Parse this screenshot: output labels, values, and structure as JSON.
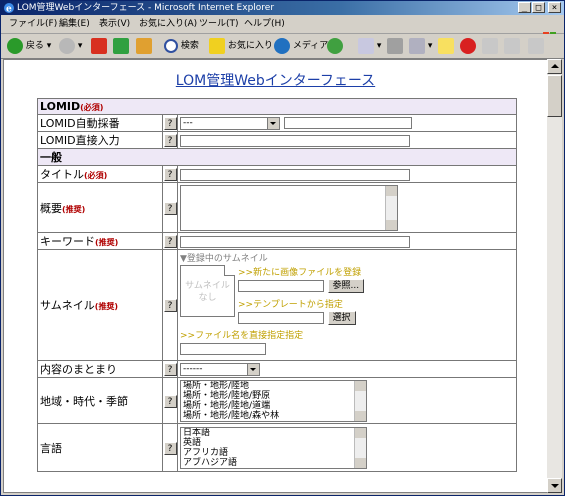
{
  "window": {
    "title": "LOM管理Webインターフェース - Microsoft Internet Explorer",
    "controls": {
      "minimize": "_",
      "maximize": "□",
      "close": "×"
    }
  },
  "menu": [
    "ファイル(F)",
    "編集(E)",
    "表示(V)",
    "お気に入り(A)",
    "ツール(T)",
    "ヘルプ(H)"
  ],
  "toolbar": {
    "back": "戻る",
    "search": "検索",
    "favorites": "お気に入り",
    "media": "メディア"
  },
  "page": {
    "title": "LOM管理Webインターフェース",
    "help_label": "?",
    "required_mark": "(必須)",
    "recommended_mark": "(推奨)",
    "sections": {
      "lomid": "LOMID",
      "general": "一般"
    },
    "rows": {
      "auto_number": {
        "label": "LOMID自動採番",
        "select_value": "---"
      },
      "direct_input": {
        "label": "LOMID直接入力"
      },
      "title": {
        "label": "タイトル"
      },
      "description": {
        "label": "概要"
      },
      "keyword": {
        "label": "キーワード"
      },
      "thumbnail": {
        "label": "サムネイル",
        "registered": "▼登録中のサムネイル",
        "placeholder_line1": "サムネイル",
        "placeholder_line2": "なし",
        "new_upload": ">>新たに画像ファイルを登録",
        "browse_button": "参照...",
        "from_template": ">>テンプレートから指定",
        "select_button": "選択",
        "direct_filename": ">>ファイル名を直接指定指定"
      },
      "aggregation": {
        "label": "内容のまとまり",
        "select_value": "------"
      },
      "coverage": {
        "label": "地域・時代・季節",
        "options": [
          "場所・地形/陸地",
          "場所・地形/陸地/野原",
          "場所・地形/陸地/道端",
          "場所・地形/陸地/森や林"
        ]
      },
      "language": {
        "label": "言語",
        "options": [
          "日本語",
          "英語",
          "アフリカ語",
          "アブハジア語"
        ]
      }
    }
  }
}
